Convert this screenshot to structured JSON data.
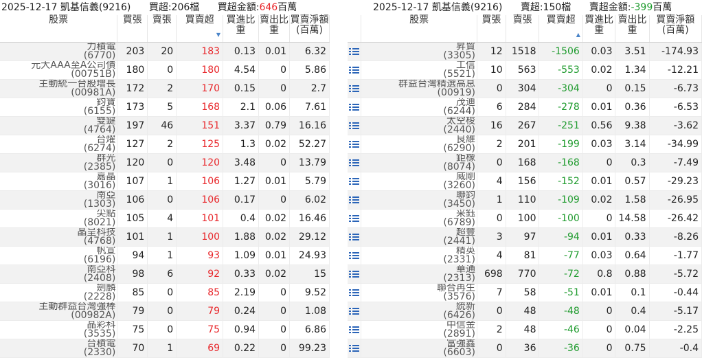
{
  "colors": {
    "positive": "#e8262a",
    "negative": "#1f9b2e",
    "icon": "#2a64b8"
  },
  "left": {
    "title": {
      "date": "2025-12-17",
      "broker": "凱基信義(9216)",
      "count_label": "買超:206檔",
      "amount_label": "買超金額:",
      "amount_value": "646",
      "amount_unit": "百萬"
    },
    "headers": {
      "stock": "股票",
      "buy": "買張",
      "sell": "賣張",
      "net": "買賣超",
      "sort_icon": "▼",
      "buy_ratio": "買進比重",
      "sell_ratio": "賣出比重",
      "net_amount": "買賣淨額(百萬)"
    },
    "rows": [
      {
        "name": "力積電",
        "code": "(6770)",
        "buy": "203",
        "sell": "20",
        "net": "183",
        "buy_ratio": "0.13",
        "sell_ratio": "0.01",
        "amount": "6.32"
      },
      {
        "name": "元大AAA至A公司債",
        "code": "(00751B)",
        "buy": "180",
        "sell": "0",
        "net": "180",
        "buy_ratio": "4.54",
        "sell_ratio": "0",
        "amount": "5.86"
      },
      {
        "name": "主動統一台股增長",
        "code": "(00981A)",
        "buy": "172",
        "sell": "2",
        "net": "170",
        "buy_ratio": "0.15",
        "sell_ratio": "0",
        "amount": "2.7"
      },
      {
        "name": "鈞寶",
        "code": "(6155)",
        "buy": "173",
        "sell": "5",
        "net": "168",
        "buy_ratio": "2.1",
        "sell_ratio": "0.06",
        "amount": "7.61"
      },
      {
        "name": "雙鍵",
        "code": "(4764)",
        "buy": "197",
        "sell": "46",
        "net": "151",
        "buy_ratio": "3.37",
        "sell_ratio": "0.79",
        "amount": "16.16"
      },
      {
        "name": "台燿",
        "code": "(6274)",
        "buy": "127",
        "sell": "2",
        "net": "125",
        "buy_ratio": "1.3",
        "sell_ratio": "0.02",
        "amount": "52.27"
      },
      {
        "name": "群光",
        "code": "(2385)",
        "buy": "120",
        "sell": "0",
        "net": "120",
        "buy_ratio": "3.48",
        "sell_ratio": "0",
        "amount": "13.79"
      },
      {
        "name": "嘉晶",
        "code": "(3016)",
        "buy": "107",
        "sell": "1",
        "net": "106",
        "buy_ratio": "1.27",
        "sell_ratio": "0.01",
        "amount": "5.79"
      },
      {
        "name": "南亞",
        "code": "(1303)",
        "buy": "106",
        "sell": "0",
        "net": "106",
        "buy_ratio": "0.17",
        "sell_ratio": "0",
        "amount": "6.02"
      },
      {
        "name": "尖點",
        "code": "(8021)",
        "buy": "105",
        "sell": "4",
        "net": "101",
        "buy_ratio": "0.4",
        "sell_ratio": "0.02",
        "amount": "16.46"
      },
      {
        "name": "晶呈科技",
        "code": "(4768)",
        "buy": "101",
        "sell": "1",
        "net": "100",
        "buy_ratio": "1.88",
        "sell_ratio": "0.02",
        "amount": "29.12"
      },
      {
        "name": "帆宣",
        "code": "(6196)",
        "buy": "94",
        "sell": "1",
        "net": "93",
        "buy_ratio": "1.09",
        "sell_ratio": "0.01",
        "amount": "24.93"
      },
      {
        "name": "南亞科",
        "code": "(2408)",
        "buy": "98",
        "sell": "6",
        "net": "92",
        "buy_ratio": "0.33",
        "sell_ratio": "0.02",
        "amount": "15"
      },
      {
        "name": "劍麟",
        "code": "(2228)",
        "buy": "85",
        "sell": "0",
        "net": "85",
        "buy_ratio": "2.19",
        "sell_ratio": "0",
        "amount": "9.52"
      },
      {
        "name": "主動群益台灣強棒",
        "code": "(00982A)",
        "buy": "79",
        "sell": "0",
        "net": "79",
        "buy_ratio": "0.24",
        "sell_ratio": "0",
        "amount": "1.08"
      },
      {
        "name": "晶彩科",
        "code": "(3535)",
        "buy": "75",
        "sell": "0",
        "net": "75",
        "buy_ratio": "0.94",
        "sell_ratio": "0",
        "amount": "6.86"
      },
      {
        "name": "台積電",
        "code": "(2330)",
        "buy": "70",
        "sell": "1",
        "net": "69",
        "buy_ratio": "0.22",
        "sell_ratio": "0",
        "amount": "99.23"
      }
    ]
  },
  "right": {
    "title": {
      "date": "2025-12-17",
      "broker": "凱基信義(9216)",
      "count_label": "賣超:150檔",
      "amount_label": "賣超金額:",
      "amount_value": "-399",
      "amount_unit": "百萬"
    },
    "headers": {
      "stock": "股票",
      "buy": "買張",
      "sell": "賣張",
      "net": "買賣超",
      "sort_icon": "▲",
      "buy_ratio": "買進比重",
      "sell_ratio": "賣出比重",
      "net_amount": "買賣淨額(百萬)"
    },
    "rows": [
      {
        "name": "昇貿",
        "code": "(3305)",
        "buy": "12",
        "sell": "1518",
        "net": "-1506",
        "buy_ratio": "0.03",
        "sell_ratio": "3.51",
        "amount": "-174.93"
      },
      {
        "name": "工信",
        "code": "(5521)",
        "buy": "10",
        "sell": "563",
        "net": "-553",
        "buy_ratio": "0.02",
        "sell_ratio": "1.34",
        "amount": "-12.21"
      },
      {
        "name": "群益台灣精選高息",
        "code": "(00919)",
        "buy": "0",
        "sell": "304",
        "net": "-304",
        "buy_ratio": "0",
        "sell_ratio": "0.15",
        "amount": "-6.73"
      },
      {
        "name": "茂迪",
        "code": "(6244)",
        "buy": "6",
        "sell": "284",
        "net": "-278",
        "buy_ratio": "0.01",
        "sell_ratio": "0.36",
        "amount": "-6.53"
      },
      {
        "name": "太空梭",
        "code": "(2440)",
        "buy": "16",
        "sell": "267",
        "net": "-251",
        "buy_ratio": "0.56",
        "sell_ratio": "9.38",
        "amount": "-3.62"
      },
      {
        "name": "良維",
        "code": "(6290)",
        "buy": "2",
        "sell": "201",
        "net": "-199",
        "buy_ratio": "0.03",
        "sell_ratio": "3.14",
        "amount": "-34.99"
      },
      {
        "name": "鉅橡",
        "code": "(8074)",
        "buy": "0",
        "sell": "168",
        "net": "-168",
        "buy_ratio": "0",
        "sell_ratio": "0.3",
        "amount": "-7.49"
      },
      {
        "name": "威剛",
        "code": "(3260)",
        "buy": "4",
        "sell": "156",
        "net": "-152",
        "buy_ratio": "0.01",
        "sell_ratio": "0.57",
        "amount": "-29.23"
      },
      {
        "name": "聯鈞",
        "code": "(3450)",
        "buy": "1",
        "sell": "110",
        "net": "-109",
        "buy_ratio": "0.02",
        "sell_ratio": "1.58",
        "amount": "-26.95"
      },
      {
        "name": "采鈺",
        "code": "(6789)",
        "buy": "0",
        "sell": "100",
        "net": "-100",
        "buy_ratio": "0",
        "sell_ratio": "14.58",
        "amount": "-26.42"
      },
      {
        "name": "超豐",
        "code": "(2441)",
        "buy": "3",
        "sell": "97",
        "net": "-94",
        "buy_ratio": "0.01",
        "sell_ratio": "0.33",
        "amount": "-8.26"
      },
      {
        "name": "精英",
        "code": "(2331)",
        "buy": "4",
        "sell": "81",
        "net": "-77",
        "buy_ratio": "0.03",
        "sell_ratio": "0.64",
        "amount": "-1.77"
      },
      {
        "name": "華通",
        "code": "(2313)",
        "buy": "698",
        "sell": "770",
        "net": "-72",
        "buy_ratio": "0.8",
        "sell_ratio": "0.88",
        "amount": "-5.72"
      },
      {
        "name": "聯合再生",
        "code": "(3576)",
        "buy": "7",
        "sell": "58",
        "net": "-51",
        "buy_ratio": "0.01",
        "sell_ratio": "0.1",
        "amount": "-0.44"
      },
      {
        "name": "統新",
        "code": "(6426)",
        "buy": "0",
        "sell": "48",
        "net": "-48",
        "buy_ratio": "0",
        "sell_ratio": "0.4",
        "amount": "-5.17"
      },
      {
        "name": "中信金",
        "code": "(2891)",
        "buy": "2",
        "sell": "48",
        "net": "-46",
        "buy_ratio": "0",
        "sell_ratio": "0.04",
        "amount": "-2.25"
      },
      {
        "name": "富強鑫",
        "code": "(6603)",
        "buy": "0",
        "sell": "36",
        "net": "-36",
        "buy_ratio": "0",
        "sell_ratio": "0.75",
        "amount": "-0.4"
      }
    ]
  }
}
